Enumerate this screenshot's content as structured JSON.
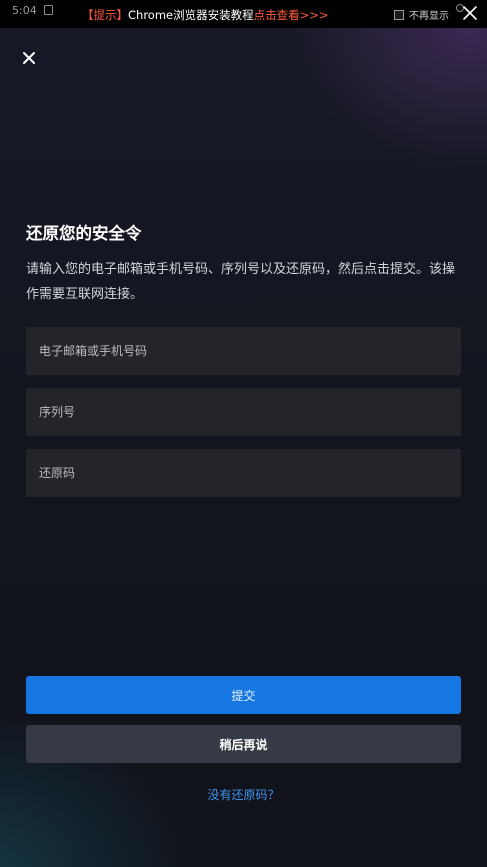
{
  "status_bar": {
    "time": "5:04"
  },
  "banner": {
    "tag": "【提示】",
    "message": "Chrome浏览器安装教程",
    "link": "点击查看>>>",
    "dont_show_label": "不再显示"
  },
  "dialog": {
    "title": "还原您的安全令",
    "description": "请输入您的电子邮箱或手机号码、序列号以及还原码，然后点击提交。该操作需要互联网连接。",
    "fields": {
      "email_placeholder": "电子邮箱或手机号码",
      "serial_placeholder": "序列号",
      "restore_placeholder": "还原码"
    },
    "submit_label": "提交",
    "later_label": "稍后再说",
    "no_code_link": "没有还原码？"
  },
  "colors": {
    "accent": "#1677e3",
    "link": "#3d94ef",
    "banner_highlight": "#ff5a3c"
  }
}
